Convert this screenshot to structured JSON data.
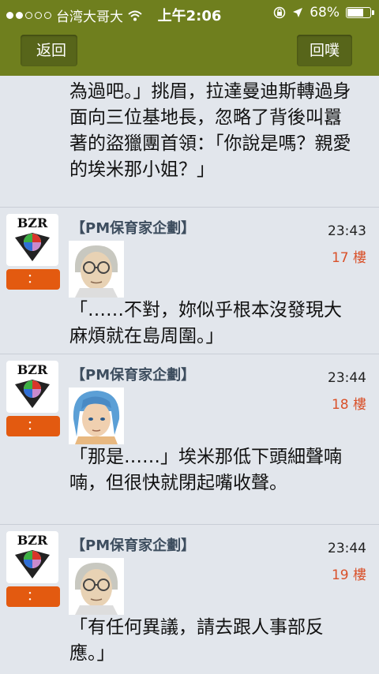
{
  "status_bar": {
    "carrier": "台湾大哥大",
    "time": "上午2:06",
    "battery": "68%",
    "battery_level": 0.68
  },
  "nav": {
    "back_label": "返回",
    "reply_label": "回噗"
  },
  "continuation_text": "為過吧。」挑眉，拉達曼迪斯轉過身面向三位基地長，忽略了背後叫囂著的盜獵團首領：「你說是嗎？親愛的埃米那小姐？」",
  "posts": [
    {
      "logo_text": "BZR",
      "more_label": "：",
      "author": "【PM保育家企劃】",
      "time": "23:43",
      "floor": "17 樓",
      "avatar": "elderly-man-glasses",
      "text": "「……不對，妳似乎根本沒發現大麻煩就在島周圍。」"
    },
    {
      "logo_text": "BZR",
      "more_label": "：",
      "author": "【PM保育家企劃】",
      "time": "23:44",
      "floor": "18 樓",
      "avatar": "blue-haired-girl",
      "text": "「那是……」埃米那低下頭細聲喃喃，但很快就閉起嘴收聲。"
    },
    {
      "logo_text": "BZR",
      "more_label": "：",
      "author": "【PM保育家企劃】",
      "time": "23:44",
      "floor": "19 樓",
      "avatar": "elderly-man-glasses",
      "text": "「有任何異議，請去跟人事部反應。」"
    }
  ]
}
